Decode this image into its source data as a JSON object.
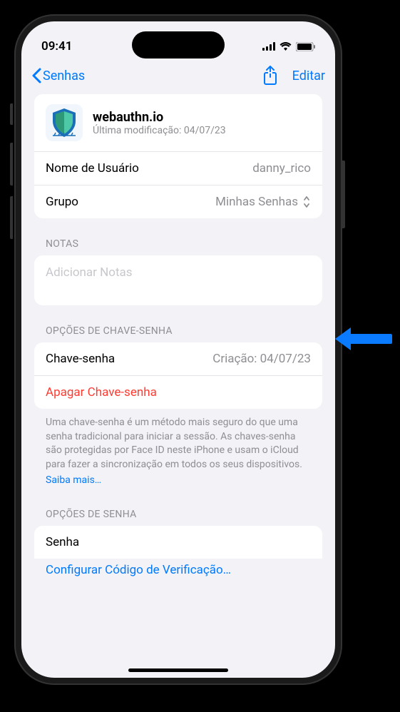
{
  "statusBar": {
    "time": "09:41"
  },
  "nav": {
    "backLabel": "Senhas",
    "editLabel": "Editar"
  },
  "site": {
    "name": "webauthn.io",
    "modifiedLabel": "Última modificação: 04/07/23"
  },
  "fields": {
    "usernameLabel": "Nome de Usuário",
    "usernameValue": "danny_rico",
    "groupLabel": "Grupo",
    "groupValue": "Minhas Senhas"
  },
  "sections": {
    "notesHeader": "NOTAS",
    "notesPlaceholder": "Adicionar Notas",
    "passkeyHeader": "OPÇÕES DE CHAVE-SENHA",
    "passkeyLabel": "Chave-senha",
    "passkeyValue": "Criação: 04/07/23",
    "deletePasskey": "Apagar Chave-senha",
    "passkeyDescription": "Uma chave-senha é um método mais seguro do que uma senha tradicional para iniciar a sessão. As chaves-senha são protegidas por Face ID neste iPhone e usam o iCloud para fazer a sincronização em todos os seus dispositivos.",
    "learnMore": "Saiba mais…",
    "passwordHeader": "OPÇÕES DE SENHA",
    "passwordLabel": "Senha",
    "verifyLabel": "Configurar Código de Verificação…"
  }
}
